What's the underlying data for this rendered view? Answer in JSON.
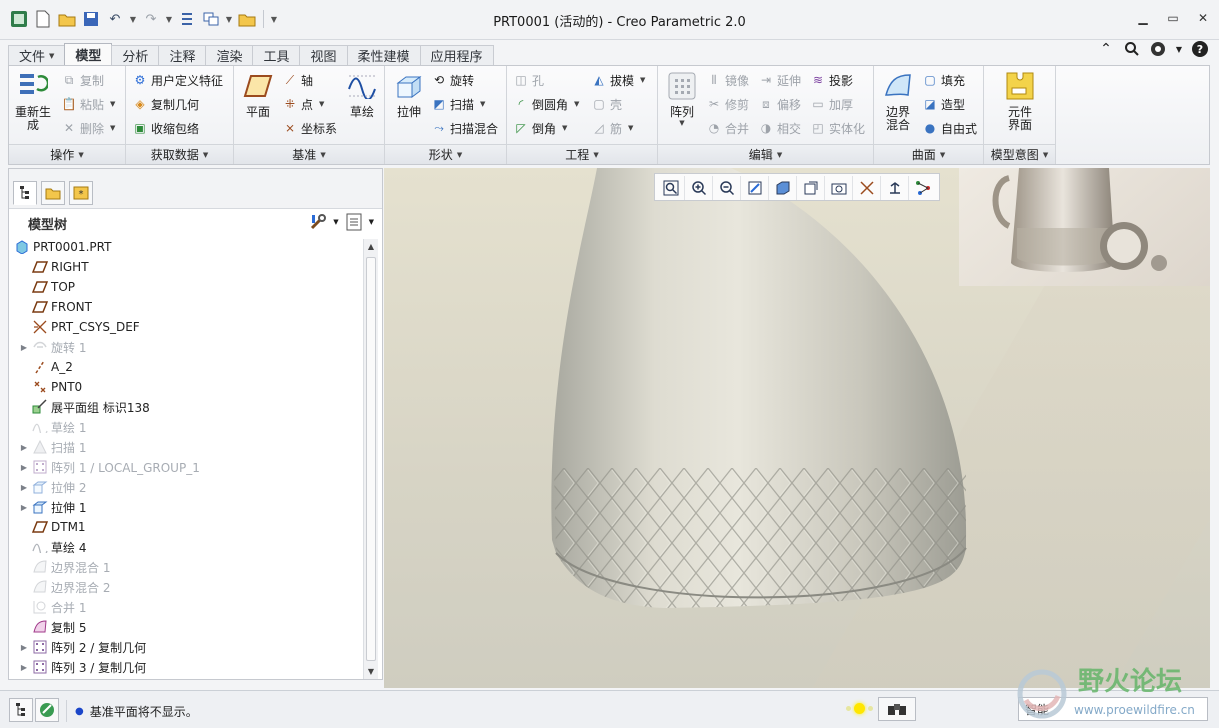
{
  "window": {
    "title": "PRT0001 (活动的) - Creo Parametric 2.0"
  },
  "ribbon_tabs": [
    "文件",
    "模型",
    "分析",
    "注释",
    "渲染",
    "工具",
    "视图",
    "柔性建模",
    "应用程序"
  ],
  "ribbon": {
    "groups": {
      "operations": "操作",
      "get_data": "获取数据",
      "datum": "基准",
      "shapes": "形状",
      "engineering": "工程",
      "editing": "编辑",
      "surfaces": "曲面",
      "model_intent": "模型意图"
    },
    "buttons": {
      "regenerate": "重新生成",
      "copy": "复制",
      "paste": "粘贴",
      "delete": "删除",
      "udf": "用户定义特征",
      "copy_geom": "复制几何",
      "shrinkwrap": "收缩包络",
      "plane": "平面",
      "axis": "轴",
      "point": "点",
      "csys": "坐标系",
      "sketch": "草绘",
      "extrude": "拉伸",
      "revolve": "旋转",
      "sweep": "扫描",
      "swept_blend": "扫描混合",
      "hole": "孔",
      "round": "倒圆角",
      "chamfer": "倒角",
      "draft": "拔模",
      "shell": "壳",
      "rib": "筋",
      "pattern": "阵列",
      "mirror": "镜像",
      "trim": "修剪",
      "merge": "合并",
      "extend": "延伸",
      "offset": "偏移",
      "intersect": "相交",
      "project": "投影",
      "thicken": "加厚",
      "solidify": "实体化",
      "boundary_blend": "边界混合",
      "fill": "填充",
      "style": "造型",
      "freestyle": "自由式",
      "component_interface": "元件界面"
    }
  },
  "panel": {
    "title": "模型树",
    "tree": [
      {
        "label": "PRT0001.PRT",
        "icon": "part-icon",
        "expander": false,
        "suppressed": false
      },
      {
        "label": "RIGHT",
        "icon": "datum-plane-icon",
        "expander": false,
        "suppressed": false
      },
      {
        "label": "TOP",
        "icon": "datum-plane-icon",
        "expander": false,
        "suppressed": false
      },
      {
        "label": "FRONT",
        "icon": "datum-plane-icon",
        "expander": false,
        "suppressed": false
      },
      {
        "label": "PRT_CSYS_DEF",
        "icon": "csys-icon",
        "expander": false,
        "suppressed": false
      },
      {
        "label": "旋转 1",
        "icon": "revolve-icon",
        "expander": true,
        "suppressed": true
      },
      {
        "label": "A_2",
        "icon": "axis-icon",
        "expander": false,
        "suppressed": false
      },
      {
        "label": "PNT0",
        "icon": "point-icon",
        "expander": false,
        "suppressed": false
      },
      {
        "label": "展平面组 标识138",
        "icon": "flatten-quilt-icon",
        "expander": false,
        "suppressed": false
      },
      {
        "label": "草绘 1",
        "icon": "sketch-icon",
        "expander": false,
        "suppressed": true
      },
      {
        "label": "扫描 1",
        "icon": "sweep-icon",
        "expander": true,
        "suppressed": true
      },
      {
        "label": "阵列 1 / LOCAL_GROUP_1",
        "icon": "pattern-icon",
        "expander": true,
        "suppressed": true
      },
      {
        "label": "拉伸 2",
        "icon": "extrude-icon",
        "expander": true,
        "suppressed": true
      },
      {
        "label": "拉伸 1",
        "icon": "extrude-icon",
        "expander": true,
        "suppressed": false
      },
      {
        "label": "DTM1",
        "icon": "datum-plane-icon",
        "expander": false,
        "suppressed": false
      },
      {
        "label": "草绘 4",
        "icon": "sketch-icon",
        "expander": false,
        "suppressed": false
      },
      {
        "label": "边界混合 1",
        "icon": "boundary-blend-icon",
        "expander": false,
        "suppressed": true
      },
      {
        "label": "边界混合 2",
        "icon": "boundary-blend-icon",
        "expander": false,
        "suppressed": true
      },
      {
        "label": "合并 1",
        "icon": "merge-icon",
        "expander": false,
        "suppressed": true
      },
      {
        "label": "复制 5",
        "icon": "copy-surface-icon",
        "expander": false,
        "suppressed": false
      },
      {
        "label": "阵列 2 / 复制几何",
        "icon": "pattern-icon",
        "expander": true,
        "suppressed": false
      },
      {
        "label": "阵列 3 / 复制几何",
        "icon": "pattern-icon",
        "expander": true,
        "suppressed": false
      }
    ]
  },
  "status": {
    "message": "基准平面将不显示。",
    "filter_value": "智能"
  },
  "watermark": {
    "name": "野火论坛",
    "url": "www.proewildfire.cn"
  },
  "colors": {
    "accent": "#2a6bd6",
    "suppressed_text": "#a7acb3",
    "model_surface": "#c9c8bd"
  }
}
